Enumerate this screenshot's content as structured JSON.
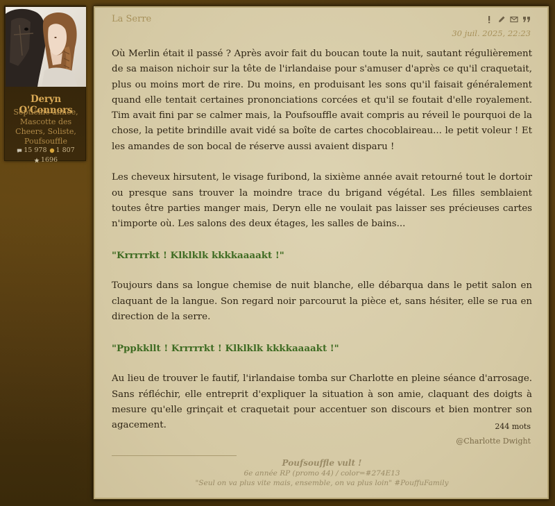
{
  "author": {
    "name": "Deryn O'Connors",
    "rank": "Septième année, Mascotte des Cheers, Soliste, Poufsouffle",
    "stats": {
      "messages": "15 978",
      "points": "1 807",
      "stars": "1696"
    }
  },
  "post": {
    "title": "La Serre",
    "date": "30 juil. 2025, 22:23",
    "actions": [
      "alert-icon",
      "edit-icon",
      "envelope-icon",
      "quote-icon"
    ],
    "paragraphs": [
      {
        "type": "text",
        "text": "Où Merlin était il passé ? Après avoir fait du boucan toute la nuit, sautant régulièrement de sa maison nichoir sur la tête de l'irlandaise pour s'amuser d'après ce qu'il craquetait, plus ou moins mort de rire. Du moins, en produisant les sons qu'il faisait généralement quand elle tentait certaines prononciations corcées et qu'il se foutait d'elle royalement. Tim avait fini par se calmer mais, la Poufsouffle avait compris au réveil le pourquoi de la chose, la petite brindille avait vidé sa boîte de cartes chocoblaireau... le petit voleur ! Et les amandes de son bocal de réserve aussi avaient disparu !"
      },
      {
        "type": "text",
        "text": "Les cheveux hirsutent, le visage furibond, la sixième année avait retourné tout le dortoir ou presque sans trouver la moindre trace du brigand végétal. Les filles semblaient toutes être parties manger mais, Deryn elle ne voulait pas laisser ses précieuses cartes n'importe où. Les salons des deux étages, les salles de bains..."
      },
      {
        "type": "dialog",
        "text": "\"Krrrrrkt ! Klklklk kkkkaaaakt !\""
      },
      {
        "type": "text",
        "text": "Toujours dans sa longue chemise de nuit blanche, elle débarqua dans le petit salon en claquant de la langue. Son regard noir parcourut la pièce et, sans hésiter, elle se rua en direction de la serre."
      },
      {
        "type": "dialog",
        "text": "\"Pppkkllt ! Krrrrrkt ! Klklklk kkkkaaaakt !\""
      },
      {
        "type": "text",
        "text": "Au lieu de trouver le fautif, l'irlandaise tomba sur Charlotte en pleine séance d'arrosage. Sans réfléchir, elle entreprit d'expliquer la situation à son amie, claquant des doigts à mesure qu'elle grinçait et craquetait pour accentuer son discours et bien montrer son agacement."
      }
    ],
    "word_count": "244 mots",
    "mention": "@Charlotte Dwight",
    "signature": {
      "title": "Poufsouffle vult !",
      "line1": "6e année RP (promo 44) / color=#274E13",
      "line2": "\"Seul on va plus vite mais, ensemble, on va plus loin\" #PouffuFamily"
    }
  },
  "colors": {
    "dialog": "#3e6b22",
    "author_name": "#d9a955",
    "post_background": "#d9ceab"
  }
}
